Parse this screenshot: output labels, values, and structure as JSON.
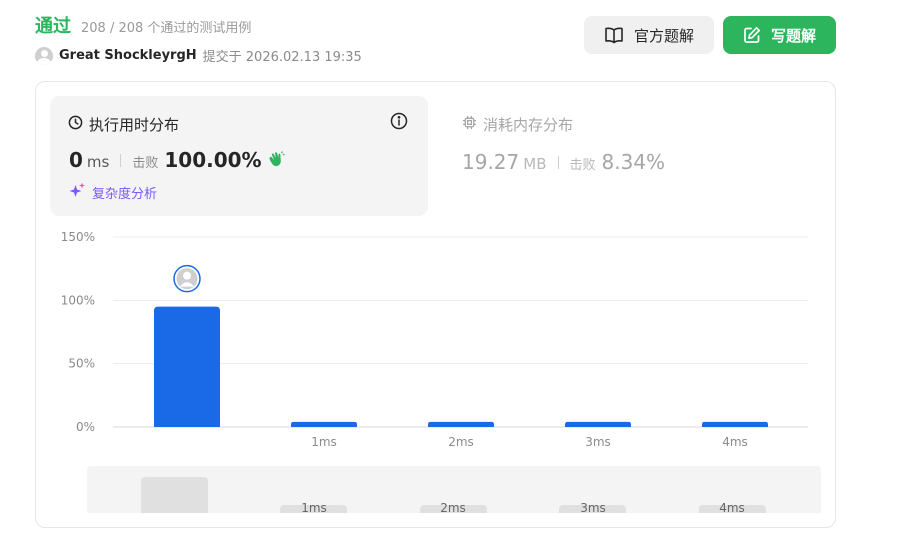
{
  "header": {
    "status": "通过",
    "passed_cases": "208 / 208 个通过的测试用例",
    "username": "Great ShockleyrgH",
    "submitted": "提交于 2026.02.13 19:35"
  },
  "buttons": {
    "official_solution": "官方题解",
    "write_solution": "写题解"
  },
  "runtime": {
    "title": "执行用时分布",
    "value": "0",
    "unit": "ms",
    "beat_label": "击败",
    "beat_pct": "100.00%",
    "complexity": "复杂度分析"
  },
  "memory": {
    "title": "消耗内存分布",
    "value": "19.27",
    "unit": "MB",
    "beat_label": "击败",
    "beat_pct": "8.34%"
  },
  "colors": {
    "accent_green": "#2db55d",
    "bar_blue": "#1a6ae8",
    "complexity_purple": "#7a5af8"
  },
  "chart_data": {
    "type": "bar",
    "categories": [
      "",
      "1ms",
      "2ms",
      "3ms",
      "4ms"
    ],
    "values": [
      95,
      4,
      4,
      4,
      4
    ],
    "ylim": [
      0,
      150
    ],
    "yticks": [
      "0%",
      "50%",
      "100%",
      "150%"
    ],
    "grid": true,
    "highlighted_index": 0
  },
  "scrubber": {
    "labels": [
      "1ms",
      "2ms",
      "3ms",
      "4ms"
    ]
  }
}
